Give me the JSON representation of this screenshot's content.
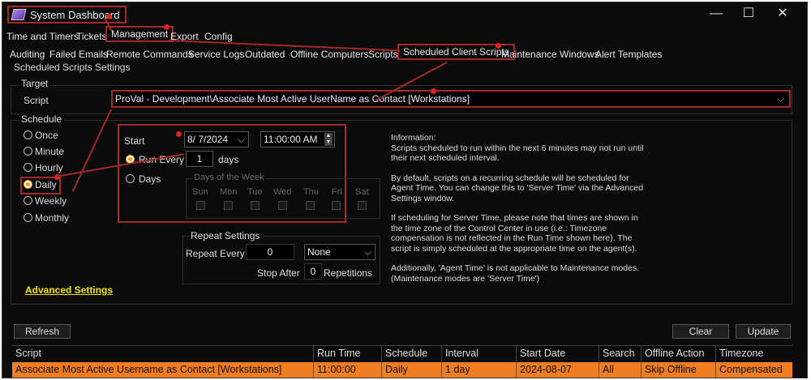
{
  "window": {
    "title": "System Dashboard",
    "minimize": "—",
    "maximize": "☐",
    "close": "✕"
  },
  "main_tabs": [
    "Time and Timers",
    "Tickets",
    "Management",
    "Export",
    "Config"
  ],
  "sub_tabs": [
    "Auditing",
    "Failed Emails",
    "Remote Commands",
    "Service Logs",
    "Outdated",
    "Offline Computers",
    "Scripts",
    "Scheduled Client Scripts",
    "Maintenance Windows",
    "Alert Templates"
  ],
  "markers": [
    "1",
    "2",
    "3",
    "4",
    "5",
    "6"
  ],
  "settings_title": "Scheduled Scripts Settings",
  "target": {
    "group": "Target",
    "script_label": "Script",
    "script_value": "ProVal - Development\\Associate Most Active UserName as Contact [Workstations]"
  },
  "schedule": {
    "group": "Schedule",
    "options": [
      "Once",
      "Minute",
      "Hourly",
      "Daily",
      "Weekly",
      "Monthly"
    ],
    "selected": "Daily",
    "start_label": "Start",
    "start_date": "8/  7/2024",
    "start_time": "11:00:00 AM",
    "run_every_label": "Run Every",
    "run_every_value": "1",
    "run_every_unit": "days",
    "days_label": "Days",
    "days_of_week_label": "Days of the Week",
    "weekdays": [
      "Sun",
      "Mon",
      "Tue",
      "Wed",
      "Thu",
      "Fri",
      "Sat"
    ]
  },
  "repeat": {
    "group": "Repeat Settings",
    "every_label": "Repeat Every",
    "every_value": "0",
    "unit": "None",
    "stop_label": "Stop After",
    "stop_value": "0",
    "repetitions_label": "Repetitions"
  },
  "info": [
    "Information:\nScripts scheduled to run within the next 6 minutes may not run until their next scheduled interval.",
    "By default, scripts on a recurring schedule will be scheduled for Agent Time. You can change this to 'Server Time' via the Advanced Settings window.",
    "If scheduling for Server Time, please note that times are shown in the time zone of the Control Center in use (i.e.: Timezone compensation is not reflected in the Run Time shown here). The script is simply scheduled at the appropriate time on the agent(s).",
    "Additionally, 'Agent Time' is not applicable to Maintenance modes. (Maintenance modes are 'Server Time')"
  ],
  "advanced_settings_link": "Advanced Settings",
  "buttons": {
    "refresh": "Refresh",
    "clear": "Clear",
    "update": "Update"
  },
  "table": {
    "columns": [
      "Script",
      "Run Time",
      "Schedule",
      "Interval",
      "Start Date",
      "Search",
      "Offline Action",
      "Timezone"
    ],
    "rows": [
      [
        "Associate Most Active Username as Contact [Workstations]",
        "11:00:00",
        "Daily",
        "1 day",
        "2024-08-07",
        "All",
        "Skip Offline",
        "Compensated"
      ]
    ]
  },
  "colors": {
    "accent_orange": "#f07d22",
    "annotation_red": "#a22a2a",
    "link_yellow": "#f5e600"
  },
  "icons": {
    "app": "app-icon",
    "dropdown": "chevron-down-icon",
    "spinner": "spinner-icon"
  }
}
